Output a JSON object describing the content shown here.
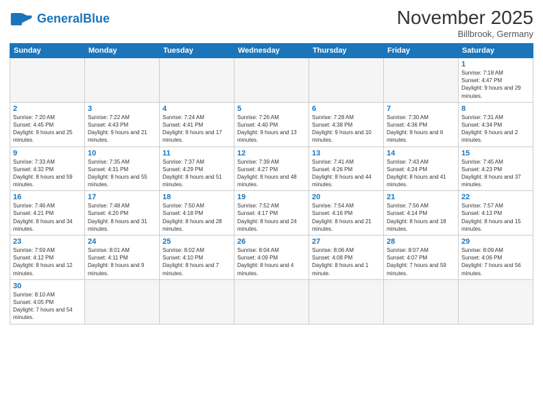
{
  "header": {
    "logo_general": "General",
    "logo_blue": "Blue",
    "month_title": "November 2025",
    "subtitle": "Billbrook, Germany"
  },
  "weekdays": [
    "Sunday",
    "Monday",
    "Tuesday",
    "Wednesday",
    "Thursday",
    "Friday",
    "Saturday"
  ],
  "weeks": [
    [
      {
        "day": "",
        "info": ""
      },
      {
        "day": "",
        "info": ""
      },
      {
        "day": "",
        "info": ""
      },
      {
        "day": "",
        "info": ""
      },
      {
        "day": "",
        "info": ""
      },
      {
        "day": "",
        "info": ""
      },
      {
        "day": "1",
        "info": "Sunrise: 7:18 AM\nSunset: 4:47 PM\nDaylight: 9 hours and 29 minutes."
      }
    ],
    [
      {
        "day": "2",
        "info": "Sunrise: 7:20 AM\nSunset: 4:45 PM\nDaylight: 9 hours and 25 minutes."
      },
      {
        "day": "3",
        "info": "Sunrise: 7:22 AM\nSunset: 4:43 PM\nDaylight: 9 hours and 21 minutes."
      },
      {
        "day": "4",
        "info": "Sunrise: 7:24 AM\nSunset: 4:41 PM\nDaylight: 9 hours and 17 minutes."
      },
      {
        "day": "5",
        "info": "Sunrise: 7:26 AM\nSunset: 4:40 PM\nDaylight: 9 hours and 13 minutes."
      },
      {
        "day": "6",
        "info": "Sunrise: 7:28 AM\nSunset: 4:38 PM\nDaylight: 9 hours and 10 minutes."
      },
      {
        "day": "7",
        "info": "Sunrise: 7:30 AM\nSunset: 4:36 PM\nDaylight: 9 hours and 6 minutes."
      },
      {
        "day": "8",
        "info": "Sunrise: 7:31 AM\nSunset: 4:34 PM\nDaylight: 9 hours and 2 minutes."
      }
    ],
    [
      {
        "day": "9",
        "info": "Sunrise: 7:33 AM\nSunset: 4:32 PM\nDaylight: 8 hours and 59 minutes."
      },
      {
        "day": "10",
        "info": "Sunrise: 7:35 AM\nSunset: 4:31 PM\nDaylight: 8 hours and 55 minutes."
      },
      {
        "day": "11",
        "info": "Sunrise: 7:37 AM\nSunset: 4:29 PM\nDaylight: 8 hours and 51 minutes."
      },
      {
        "day": "12",
        "info": "Sunrise: 7:39 AM\nSunset: 4:27 PM\nDaylight: 8 hours and 48 minutes."
      },
      {
        "day": "13",
        "info": "Sunrise: 7:41 AM\nSunset: 4:26 PM\nDaylight: 8 hours and 44 minutes."
      },
      {
        "day": "14",
        "info": "Sunrise: 7:43 AM\nSunset: 4:24 PM\nDaylight: 8 hours and 41 minutes."
      },
      {
        "day": "15",
        "info": "Sunrise: 7:45 AM\nSunset: 4:23 PM\nDaylight: 8 hours and 37 minutes."
      }
    ],
    [
      {
        "day": "16",
        "info": "Sunrise: 7:46 AM\nSunset: 4:21 PM\nDaylight: 8 hours and 34 minutes."
      },
      {
        "day": "17",
        "info": "Sunrise: 7:48 AM\nSunset: 4:20 PM\nDaylight: 8 hours and 31 minutes."
      },
      {
        "day": "18",
        "info": "Sunrise: 7:50 AM\nSunset: 4:18 PM\nDaylight: 8 hours and 28 minutes."
      },
      {
        "day": "19",
        "info": "Sunrise: 7:52 AM\nSunset: 4:17 PM\nDaylight: 8 hours and 24 minutes."
      },
      {
        "day": "20",
        "info": "Sunrise: 7:54 AM\nSunset: 4:16 PM\nDaylight: 8 hours and 21 minutes."
      },
      {
        "day": "21",
        "info": "Sunrise: 7:56 AM\nSunset: 4:14 PM\nDaylight: 8 hours and 18 minutes."
      },
      {
        "day": "22",
        "info": "Sunrise: 7:57 AM\nSunset: 4:13 PM\nDaylight: 8 hours and 15 minutes."
      }
    ],
    [
      {
        "day": "23",
        "info": "Sunrise: 7:59 AM\nSunset: 4:12 PM\nDaylight: 8 hours and 12 minutes."
      },
      {
        "day": "24",
        "info": "Sunrise: 8:01 AM\nSunset: 4:11 PM\nDaylight: 8 hours and 9 minutes."
      },
      {
        "day": "25",
        "info": "Sunrise: 8:02 AM\nSunset: 4:10 PM\nDaylight: 8 hours and 7 minutes."
      },
      {
        "day": "26",
        "info": "Sunrise: 8:04 AM\nSunset: 4:09 PM\nDaylight: 8 hours and 4 minutes."
      },
      {
        "day": "27",
        "info": "Sunrise: 8:06 AM\nSunset: 4:08 PM\nDaylight: 8 hours and 1 minute."
      },
      {
        "day": "28",
        "info": "Sunrise: 8:07 AM\nSunset: 4:07 PM\nDaylight: 7 hours and 59 minutes."
      },
      {
        "day": "29",
        "info": "Sunrise: 8:09 AM\nSunset: 4:06 PM\nDaylight: 7 hours and 56 minutes."
      }
    ],
    [
      {
        "day": "30",
        "info": "Sunrise: 8:10 AM\nSunset: 4:05 PM\nDaylight: 7 hours and 54 minutes."
      },
      {
        "day": "",
        "info": ""
      },
      {
        "day": "",
        "info": ""
      },
      {
        "day": "",
        "info": ""
      },
      {
        "day": "",
        "info": ""
      },
      {
        "day": "",
        "info": ""
      },
      {
        "day": "",
        "info": ""
      }
    ]
  ]
}
